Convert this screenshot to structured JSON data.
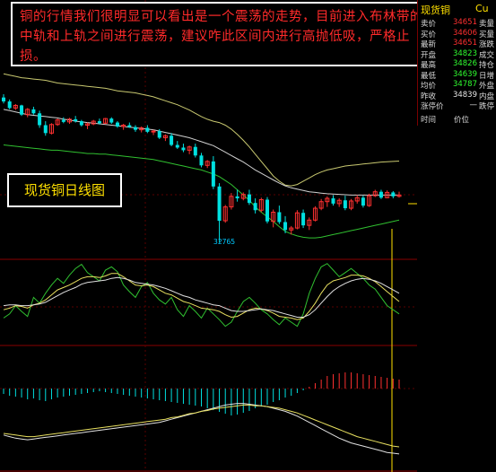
{
  "annotation": {
    "text": "铜的行情我们很明显可以看出是一个震荡的走势，目前进入布林带的中轨和上轨之间进行震荡，建议咋此区间内进行高抛低吸，严格止损。"
  },
  "chart_title": "现货铜日线图",
  "low_marker": "32765",
  "quote_panel": {
    "name": "现货铜",
    "code": "Cu",
    "rows": [
      {
        "label": "卖价",
        "value": "34651",
        "tone": "red",
        "label2": "卖量"
      },
      {
        "label": "买价",
        "value": "34606",
        "tone": "red",
        "label2": "买量"
      },
      {
        "label": "最新",
        "value": "34651",
        "tone": "red",
        "label2": "涨跌"
      },
      {
        "label": "开盘",
        "value": "34823",
        "tone": "grn",
        "label2": "成交"
      },
      {
        "label": "最高",
        "value": "34826",
        "tone": "grn",
        "label2": "持仓"
      },
      {
        "label": "最低",
        "value": "34639",
        "tone": "grn",
        "label2": "日增"
      },
      {
        "label": "均价",
        "value": "34787",
        "tone": "grn",
        "label2": "外盘"
      },
      {
        "label": "昨收",
        "value": "34839",
        "tone": "wht",
        "label2": "内盘"
      },
      {
        "label": "涨停价",
        "value": "—",
        "tone": "wht",
        "label2": "跌停"
      }
    ],
    "col_time": "时间",
    "col_price": "价位"
  },
  "chart_data": {
    "type": "candlestick",
    "candles": [
      [
        34960,
        35010,
        34870,
        34900
      ],
      [
        34900,
        34930,
        34780,
        34800
      ],
      [
        34800,
        34860,
        34770,
        34840
      ],
      [
        34840,
        34850,
        34680,
        34700
      ],
      [
        34700,
        34800,
        34660,
        34780
      ],
      [
        34780,
        34820,
        34700,
        34720
      ],
      [
        34720,
        34760,
        34500,
        34540
      ],
      [
        34540,
        34600,
        34380,
        34420
      ],
      [
        34420,
        34570,
        34400,
        34550
      ],
      [
        34550,
        34640,
        34530,
        34620
      ],
      [
        34620,
        34660,
        34570,
        34590
      ],
      [
        34590,
        34650,
        34560,
        34630
      ],
      [
        34630,
        34680,
        34580,
        34600
      ],
      [
        34600,
        34620,
        34520,
        34540
      ],
      [
        34540,
        34580,
        34480,
        34560
      ],
      [
        34560,
        34620,
        34540,
        34600
      ],
      [
        34600,
        34640,
        34550,
        34570
      ],
      [
        34570,
        34650,
        34560,
        34640
      ],
      [
        34640,
        34660,
        34560,
        34580
      ],
      [
        34580,
        34600,
        34500,
        34520
      ],
      [
        34520,
        34560,
        34470,
        34540
      ],
      [
        34540,
        34580,
        34500,
        34510
      ],
      [
        34510,
        34540,
        34440,
        34470
      ],
      [
        34470,
        34520,
        34430,
        34500
      ],
      [
        34500,
        34540,
        34420,
        34440
      ],
      [
        34440,
        34470,
        34390,
        34450
      ],
      [
        34450,
        34480,
        34330,
        34350
      ],
      [
        34350,
        34400,
        34300,
        34380
      ],
      [
        34380,
        34420,
        34220,
        34240
      ],
      [
        34240,
        34300,
        34180,
        34200
      ],
      [
        34200,
        34260,
        34130,
        34160
      ],
      [
        34160,
        34230,
        34100,
        34210
      ],
      [
        34210,
        34260,
        34050,
        34080
      ],
      [
        34080,
        34120,
        33900,
        33930
      ],
      [
        33930,
        34010,
        33890,
        33990
      ],
      [
        33990,
        34070,
        33570,
        33610
      ],
      [
        33610,
        33660,
        32765,
        33090
      ],
      [
        33090,
        33330,
        33060,
        33300
      ],
      [
        33300,
        33510,
        33260,
        33460
      ],
      [
        33460,
        33560,
        33380,
        33430
      ],
      [
        33430,
        33520,
        33400,
        33490
      ],
      [
        33490,
        33560,
        33330,
        33360
      ],
      [
        33360,
        33430,
        33200,
        33250
      ],
      [
        33250,
        33440,
        33220,
        33410
      ],
      [
        33410,
        33450,
        33050,
        33080
      ],
      [
        33080,
        33260,
        32990,
        33220
      ],
      [
        33220,
        33320,
        33040,
        33070
      ],
      [
        33070,
        33160,
        32900,
        32950
      ],
      [
        32950,
        33010,
        32880,
        32980
      ],
      [
        32980,
        33250,
        32960,
        33210
      ],
      [
        33210,
        33260,
        32980,
        33020
      ],
      [
        33020,
        33140,
        32950,
        33100
      ],
      [
        33100,
        33310,
        33080,
        33280
      ],
      [
        33280,
        33420,
        33250,
        33380
      ],
      [
        33380,
        33460,
        33300,
        33430
      ],
      [
        33430,
        33480,
        33320,
        33350
      ],
      [
        33350,
        33430,
        33300,
        33400
      ],
      [
        33400,
        33470,
        33250,
        33280
      ],
      [
        33280,
        33420,
        33250,
        33390
      ],
      [
        33390,
        33480,
        33350,
        33440
      ],
      [
        33440,
        33470,
        33290,
        33320
      ],
      [
        33320,
        33500,
        33300,
        33470
      ],
      [
        33470,
        33560,
        33450,
        33530
      ],
      [
        33530,
        33560,
        33420,
        33440
      ],
      [
        33440,
        33550,
        33430,
        33520
      ],
      [
        33520,
        33540,
        33430,
        33460
      ],
      [
        33460,
        33530,
        33440,
        33480
      ]
    ],
    "bollinger": {
      "upper": [
        35320,
        35300,
        35280,
        35260,
        35250,
        35240,
        35230,
        35220,
        35200,
        35180,
        35170,
        35160,
        35150,
        35140,
        35130,
        35120,
        35110,
        35100,
        35080,
        35060,
        35050,
        35040,
        35030,
        35010,
        34990,
        34970,
        34940,
        34910,
        34880,
        34850,
        34810,
        34770,
        34720,
        34670,
        34630,
        34600,
        34580,
        34540,
        34480,
        34400,
        34310,
        34210,
        34100,
        33990,
        33880,
        33770,
        33690,
        33630,
        33620,
        33640,
        33690,
        33740,
        33790,
        33830,
        33860,
        33880,
        33900,
        33920,
        33930,
        33940,
        33950,
        33960,
        33970,
        33980,
        33985,
        33990,
        33995
      ],
      "middle": [
        34780,
        34760,
        34740,
        34720,
        34700,
        34690,
        34680,
        34670,
        34660,
        34650,
        34630,
        34620,
        34600,
        34590,
        34580,
        34570,
        34560,
        34550,
        34540,
        34530,
        34520,
        34510,
        34500,
        34490,
        34480,
        34470,
        34450,
        34430,
        34410,
        34390,
        34370,
        34350,
        34320,
        34290,
        34260,
        34230,
        34180,
        34130,
        34080,
        34030,
        33980,
        33920,
        33860,
        33810,
        33760,
        33710,
        33660,
        33620,
        33590,
        33570,
        33550,
        33530,
        33520,
        33510,
        33500,
        33495,
        33490,
        33485,
        33480,
        33480,
        33480,
        33480,
        33480,
        33480,
        33480,
        33480,
        33480
      ],
      "lower": [
        34240,
        34230,
        34220,
        34210,
        34200,
        34190,
        34180,
        34170,
        34160,
        34160,
        34150,
        34140,
        34130,
        34120,
        34110,
        34110,
        34100,
        34100,
        34090,
        34080,
        34070,
        34060,
        34050,
        34040,
        34030,
        34020,
        34000,
        33980,
        33960,
        33940,
        33920,
        33900,
        33880,
        33860,
        33830,
        33800,
        33760,
        33700,
        33640,
        33560,
        33480,
        33400,
        33300,
        33220,
        33150,
        33080,
        33000,
        32930,
        32890,
        32860,
        32840,
        32830,
        32830,
        32840,
        32860,
        32880,
        32900,
        32920,
        32940,
        32960,
        32980,
        33000,
        33020,
        33040,
        33060,
        33080,
        33100
      ]
    },
    "indicator1_lines": {
      "green": [
        30,
        35,
        45,
        38,
        32,
        55,
        48,
        60,
        70,
        78,
        72,
        82,
        90,
        95,
        85,
        80,
        75,
        88,
        92,
        86,
        70,
        62,
        55,
        68,
        73,
        60,
        52,
        47,
        55,
        40,
        32,
        45,
        38,
        30,
        42,
        35,
        28,
        20,
        25,
        38,
        50,
        55,
        48,
        40,
        35,
        28,
        22,
        30,
        25,
        20,
        35,
        60,
        78,
        92,
        96,
        88,
        80,
        85,
        90,
        84,
        78,
        70,
        65,
        55,
        45,
        40,
        35
      ],
      "yellow": [
        40,
        42,
        45,
        44,
        42,
        46,
        48,
        52,
        58,
        64,
        67,
        70,
        74,
        78,
        80,
        80,
        79,
        81,
        84,
        84,
        80,
        75,
        70,
        69,
        70,
        68,
        64,
        60,
        58,
        54,
        50,
        48,
        45,
        42,
        41,
        40,
        38,
        34,
        31,
        32,
        36,
        40,
        42,
        41,
        39,
        36,
        32,
        31,
        30,
        28,
        30,
        38,
        48,
        60,
        70,
        75,
        77,
        79,
        82,
        82,
        81,
        78,
        74,
        68,
        62,
        56,
        50
      ],
      "white": [
        45,
        46,
        46,
        45,
        45,
        46,
        47,
        49,
        53,
        57,
        61,
        64,
        67,
        71,
        73,
        74,
        75,
        76,
        78,
        79,
        78,
        76,
        73,
        72,
        71,
        70,
        68,
        66,
        63,
        60,
        57,
        55,
        52,
        50,
        48,
        46,
        45,
        42,
        39,
        38,
        38,
        39,
        40,
        41,
        40,
        39,
        37,
        35,
        33,
        31,
        31,
        34,
        40,
        48,
        56,
        63,
        68,
        72,
        75,
        77,
        78,
        77,
        75,
        72,
        68,
        64,
        60
      ]
    },
    "indicator2_macd": [
      -6,
      -8,
      -9,
      -10,
      -12,
      -11,
      -13,
      -14,
      -12,
      -10,
      -9,
      -8,
      -7,
      -6,
      -5,
      -4,
      -3,
      -4,
      -5,
      -6,
      -7,
      -8,
      -9,
      -10,
      -11,
      -12,
      -13,
      -14,
      -15,
      -16,
      -17,
      -18,
      -19,
      -20,
      -22,
      -24,
      -26,
      -28,
      -30,
      -29,
      -27,
      -25,
      -22,
      -20,
      -18,
      -15,
      -13,
      -10,
      -8,
      -5,
      -2,
      2,
      6,
      10,
      14,
      16,
      17,
      18,
      18,
      17,
      16,
      15,
      14,
      13,
      12,
      11,
      10
    ],
    "indicator2_lines": {
      "white": [
        40,
        38,
        36,
        35,
        34,
        35,
        36,
        37,
        38,
        39,
        40,
        41,
        42,
        43,
        44,
        45,
        46,
        47,
        48,
        49,
        50,
        51,
        52,
        53,
        54,
        55,
        56,
        58,
        60,
        62,
        64,
        66,
        68,
        70,
        72,
        74,
        76,
        78,
        79,
        80,
        80,
        79,
        78,
        77,
        76,
        74,
        72,
        70,
        67,
        64,
        60,
        56,
        52,
        48,
        44,
        40,
        36,
        33,
        30,
        28,
        26,
        24,
        22,
        20,
        18,
        17,
        16
      ],
      "yellow": [
        42,
        41,
        40,
        39,
        38,
        38,
        39,
        40,
        41,
        42,
        43,
        44,
        45,
        46,
        47,
        48,
        49,
        50,
        51,
        52,
        53,
        54,
        55,
        56,
        57,
        58,
        59,
        60,
        62,
        63,
        65,
        67,
        68,
        70,
        71,
        73,
        74,
        75,
        76,
        77,
        78,
        78,
        77,
        77,
        76,
        75,
        74,
        72,
        70,
        68,
        65,
        62,
        59,
        56,
        53,
        50,
        47,
        44,
        41,
        38,
        36,
        34,
        32,
        30,
        28,
        26,
        25
      ]
    }
  }
}
